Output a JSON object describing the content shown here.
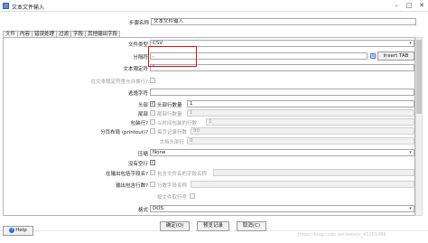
{
  "window": {
    "title": "文本文件输入"
  },
  "step_name": {
    "label": "步骤名称",
    "value": "文本文件输入"
  },
  "tabs": [
    "文件",
    "内容",
    "错误处理",
    "过滤",
    "字段",
    "其他输出字段"
  ],
  "fields": {
    "file_type": {
      "label": "文件类型",
      "value": "CSV"
    },
    "separator": {
      "label": "分隔符",
      "value": ",",
      "button": "Insert TAB"
    },
    "enclosure": {
      "label": "文本限定符",
      "value": "\""
    },
    "enclosure_breaks": {
      "label": "在文本限定符里允许换行?"
    },
    "escape": {
      "label": "逃逸字符",
      "value": ""
    },
    "header": {
      "label": "头部",
      "checkbox_label": "头部行数量",
      "value": "1"
    },
    "footer": {
      "label": "尾部",
      "checkbox_label": "尾部行数量",
      "value": "1"
    },
    "wrapped": {
      "label": "包装行?",
      "checkbox_label": "以时间包装的行数",
      "value": "1"
    },
    "paging": {
      "label": "分页布局 (printout)?",
      "checkbox_label": "每页记录行数",
      "value": "80"
    },
    "doc_header": {
      "label": "文档头部行",
      "value": "0"
    },
    "compression": {
      "label": "压缩",
      "value": "None"
    },
    "no_empty": {
      "label": "没有空行",
      "checked": "✓"
    },
    "include_filename": {
      "label": "在输出包括字段名?",
      "checkbox_label": "包含文件名的字段名称",
      "value": ""
    },
    "include_rownum": {
      "label": "输出包含行数?",
      "checkbox_label": "行数字段名称",
      "value": ""
    },
    "rownum_by_file": {
      "label": "按文件取行号"
    },
    "format": {
      "label": "格式",
      "value": "DOS"
    }
  },
  "buttons": {
    "ok": "确定(O)",
    "preview": "预览记录",
    "cancel": "取消(C)",
    "help": "Help"
  },
  "watermark": "https://blog.csdn.net/weixin_45101088"
}
